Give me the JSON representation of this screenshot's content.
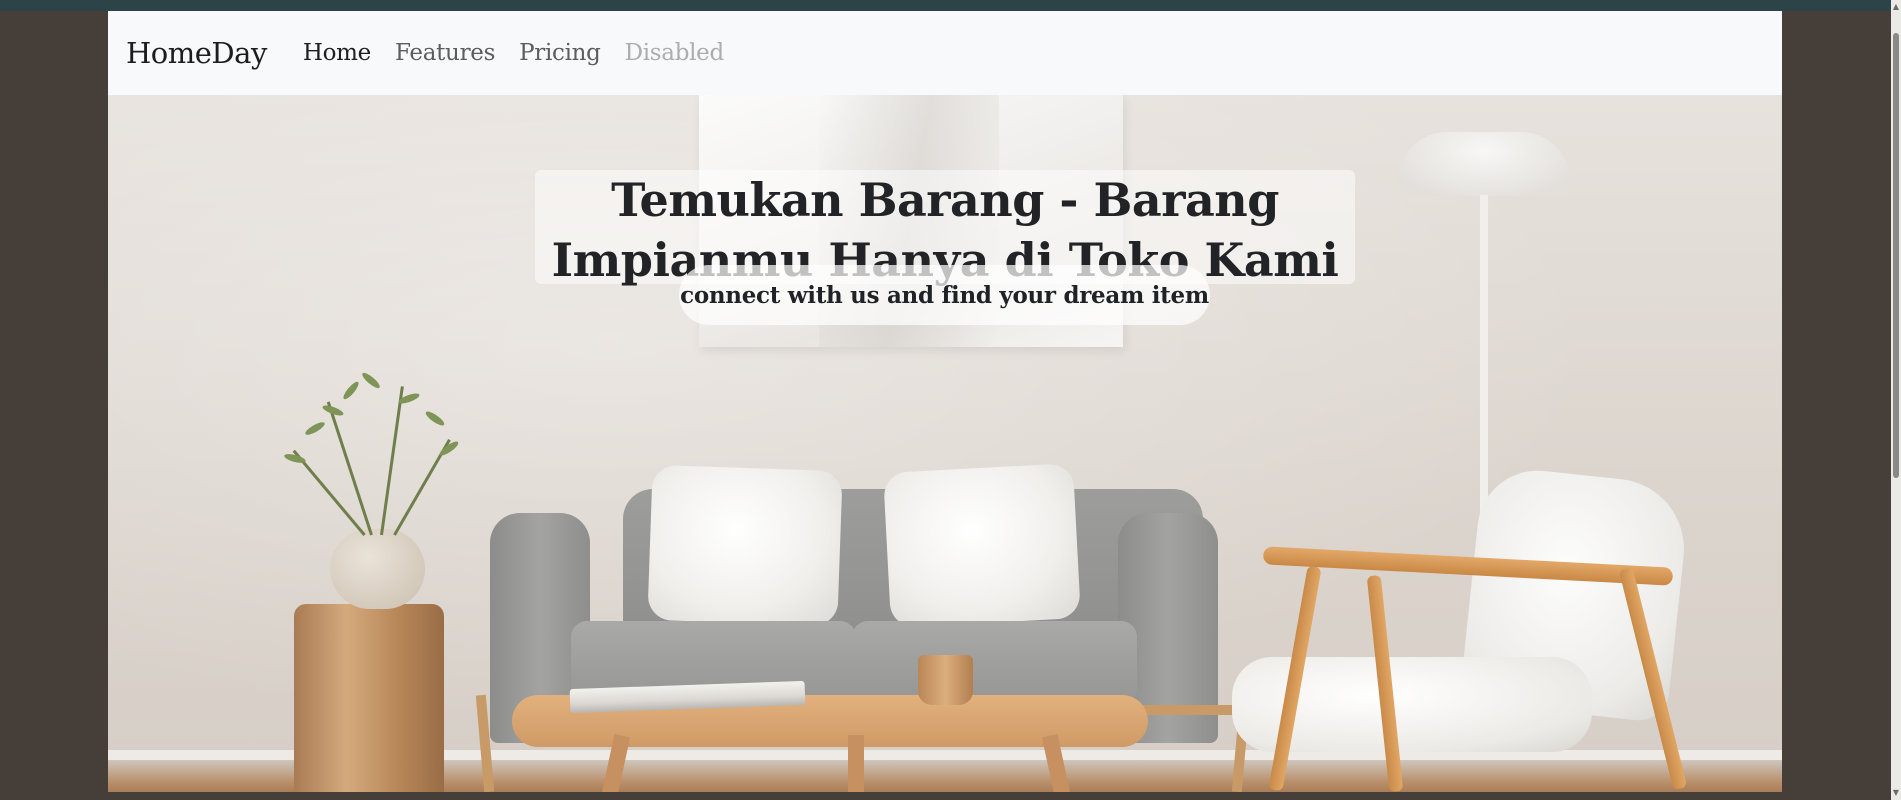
{
  "navbar": {
    "brand": "HomeDay",
    "links": [
      {
        "label": "Home",
        "state": "active"
      },
      {
        "label": "Features",
        "state": "normal"
      },
      {
        "label": "Pricing",
        "state": "normal"
      },
      {
        "label": "Disabled",
        "state": "disabled"
      }
    ]
  },
  "hero": {
    "title": "Temukan Barang - Barang Impianmu Hanya di Toko Kami",
    "subtitle": "connect with us and find your dream item",
    "background_image": "living-room-with-grey-sofa-and-wooden-armchair"
  },
  "colors": {
    "page_background": "#463e39",
    "top_strip": "#2c4448",
    "navbar_background": "#f7f9fb",
    "title_text": "#212327"
  },
  "icons": {
    "scroll_up": "scroll-up-arrow-icon",
    "scroll_down": "scroll-down-arrow-icon"
  }
}
